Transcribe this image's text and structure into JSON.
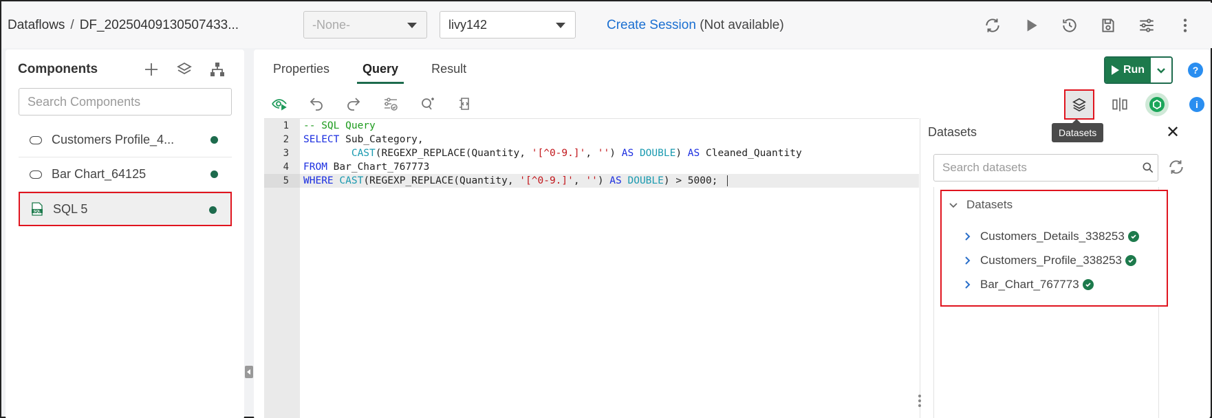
{
  "breadcrumb": {
    "root": "Dataflows",
    "separator": "/",
    "current": "DF_20250409130507433..."
  },
  "header": {
    "select_none": "-None-",
    "select_livy": "livy142",
    "create_session_link": "Create Session",
    "session_status": "(Not available)"
  },
  "components": {
    "title": "Components",
    "search_placeholder": "Search Components",
    "items": [
      {
        "label": "Customers Profile_4...",
        "status_color": "#1d6b4d"
      },
      {
        "label": "Bar Chart_64125",
        "status_color": "#1d6b4d"
      },
      {
        "label": "SQL 5",
        "status_color": "#1d6b4d",
        "selected": true
      }
    ],
    "sql_icon_text": "SQL"
  },
  "tabs": [
    {
      "label": "Properties"
    },
    {
      "label": "Query",
      "active": true
    },
    {
      "label": "Result"
    }
  ],
  "run_button": {
    "label": "Run"
  },
  "help_label": "?",
  "info_label": "i",
  "tooltip": "Datasets",
  "editor": {
    "line_numbers": [
      "1",
      "2",
      "3",
      "4",
      "5"
    ]
  },
  "datasets": {
    "title": "Datasets",
    "close_label": "✕",
    "search_placeholder": "Search datasets",
    "tree_root": "Datasets",
    "items": [
      {
        "label": "Customers_Details_338253"
      },
      {
        "label": "Customers_Profile_338253"
      },
      {
        "label": "Bar_Chart_767773"
      }
    ]
  },
  "colors": {
    "accent_green": "#1d7a4c",
    "link_blue": "#1a6fd1",
    "highlight_red": "#e0141e",
    "info_blue": "#2a8ef0"
  }
}
